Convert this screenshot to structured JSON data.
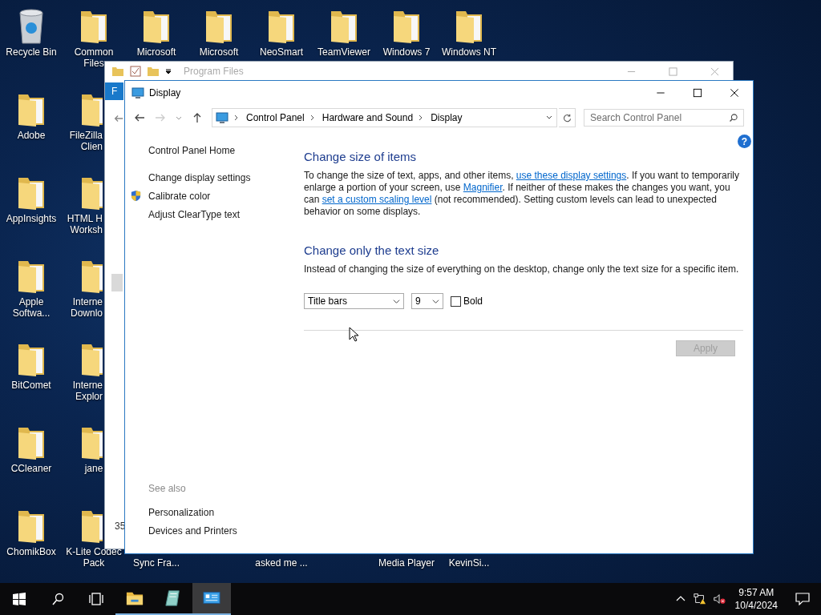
{
  "desktop": {
    "top_row": [
      {
        "label": "Recycle Bin",
        "kind": "recycle"
      },
      {
        "label": "Common Files",
        "kind": "folder"
      },
      {
        "label": "Microsoft",
        "kind": "folder"
      },
      {
        "label": "Microsoft",
        "kind": "folder"
      },
      {
        "label": "NeoSmart",
        "kind": "folder"
      },
      {
        "label": "TeamViewer",
        "kind": "folder"
      },
      {
        "label": "Windows 7",
        "kind": "folder"
      },
      {
        "label": "Windows NT",
        "kind": "folder"
      }
    ],
    "columns": [
      [
        {
          "label": "Adobe",
          "kind": "folder",
          "clipped": false
        },
        {
          "label": "AppInsights",
          "kind": "folder",
          "clipped": false
        },
        {
          "label": "Apple Softwa...",
          "kind": "folder",
          "clipped": false
        },
        {
          "label": "BitComet",
          "kind": "folder",
          "clipped": false
        },
        {
          "label": "CCleaner",
          "kind": "folder",
          "clipped": false
        },
        {
          "label": "ChomikBox",
          "kind": "folder",
          "clipped": false
        }
      ],
      [
        {
          "label": "FileZilla\nClien",
          "kind": "folder",
          "clipped": true
        },
        {
          "label": "HTML H\nWorksh",
          "kind": "folder",
          "clipped": true
        },
        {
          "label": "Interne\nDownlo",
          "kind": "folder",
          "clipped": true
        },
        {
          "label": "Interne\nExplor",
          "kind": "folder",
          "clipped": true
        },
        {
          "label": "jane",
          "kind": "folder",
          "clipped": false
        },
        {
          "label": "K-Lite Codec Pack",
          "kind": "folder",
          "clipped": false
        }
      ]
    ],
    "partly_hidden_labels": [
      "Sync Fra...",
      "asked me ...",
      "Media Player",
      "KevinSi..."
    ]
  },
  "back_window": {
    "title": "Program Files",
    "ribbon_tab": "F",
    "status": "35"
  },
  "window": {
    "title": "Display",
    "breadcrumb": [
      "Control Panel",
      "Hardware and Sound",
      "Display"
    ],
    "search": {
      "placeholder": "Search Control Panel"
    },
    "help_glyph": "?",
    "sidebar": {
      "home": "Control Panel Home",
      "links": [
        {
          "label": "Change display settings",
          "kind": "link"
        },
        {
          "label": "Calibrate color",
          "kind": "admin"
        },
        {
          "label": "Adjust ClearType text",
          "kind": "link"
        }
      ],
      "see_also_heading": "See also",
      "see_also": [
        "Personalization",
        "Devices and Printers"
      ]
    },
    "sections": [
      {
        "heading": "Change size of items",
        "parts": [
          {
            "kind": "text",
            "text": "To change the size of text, apps, and other items, "
          },
          {
            "kind": "link",
            "text": "use these display settings"
          },
          {
            "kind": "text",
            "text": ".  If you want to temporarily enlarge a portion of your screen, use "
          },
          {
            "kind": "link",
            "text": "Magnifier"
          },
          {
            "kind": "text",
            "text": ".  If neither of these makes the changes you want, you can "
          },
          {
            "kind": "link",
            "text": "set a custom scaling level"
          },
          {
            "kind": "text",
            "text": " (not recommended).  Setting custom levels can lead to unexpected behavior on some displays."
          }
        ]
      },
      {
        "heading": "Change only the text size",
        "parts": [
          {
            "kind": "text",
            "text": "Instead of changing the size of everything on the desktop, change only the text size for a specific item."
          }
        ]
      }
    ],
    "item_select": "Title bars",
    "size_select": "9",
    "bold": {
      "label": "Bold",
      "checked": false
    },
    "apply": {
      "label": "Apply",
      "disabled": true
    }
  },
  "taskbar": {
    "apps": [
      {
        "kind": "explorer",
        "running": true,
        "selected": false
      },
      {
        "kind": "notepad",
        "running": true,
        "selected": false
      },
      {
        "kind": "control",
        "running": true,
        "selected": true
      }
    ],
    "time": "9:57 AM",
    "date": "10/4/2024"
  }
}
